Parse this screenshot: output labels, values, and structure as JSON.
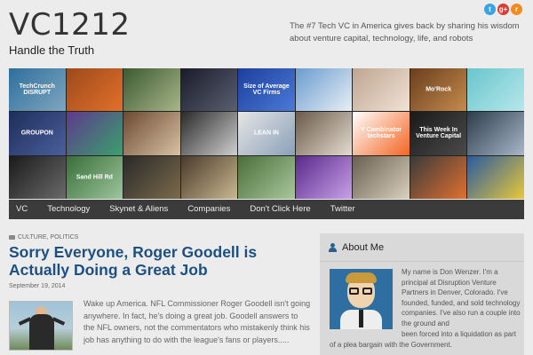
{
  "site": {
    "title": "VC1212",
    "tagline": "Handle the Truth",
    "description": "The #7 Tech VC in America gives back by sharing his wisdom about venture capital, technology, life, and robots"
  },
  "social": [
    {
      "name": "twitter",
      "glyph": "t",
      "color": "#3aa3e3"
    },
    {
      "name": "google-plus",
      "glyph": "g+",
      "color": "#d73d32"
    },
    {
      "name": "rss",
      "glyph": "r",
      "color": "#f28b1f"
    }
  ],
  "mosaic": [
    {
      "name": "techcrunch-disrupt",
      "label": "TechCrunch DISRUPT",
      "colors": [
        "#2e6f9c",
        "#7ea6c0"
      ]
    },
    {
      "name": "football-player",
      "label": "",
      "colors": [
        "#9c4a1c",
        "#e2702a"
      ]
    },
    {
      "name": "google-glass-portrait",
      "label": "",
      "colors": [
        "#3d5a30",
        "#a8b58a"
      ]
    },
    {
      "name": "terminator",
      "label": "",
      "colors": [
        "#1a1a2a",
        "#5a6070"
      ]
    },
    {
      "name": "vc-firms-chart",
      "label": "Size of Average VC Firms",
      "colors": [
        "#1d3f9c",
        "#4a7ad9"
      ]
    },
    {
      "name": "skier",
      "label": "",
      "colors": [
        "#6a9ccf",
        "#e8eff5"
      ]
    },
    {
      "name": "marissa-mayer",
      "label": "",
      "colors": [
        "#bfa590",
        "#f0e3d6"
      ]
    },
    {
      "name": "book-cover",
      "label": "Mo'Rock",
      "colors": [
        "#6a3e1e",
        "#c48b4d"
      ]
    },
    {
      "name": "whale-cartoon",
      "label": "",
      "colors": [
        "#69c5cd",
        "#b6e8ea"
      ]
    },
    {
      "name": "groupon-nasdaq",
      "label": "GROUPON",
      "colors": [
        "#1e2d5a",
        "#4a5f9c"
      ]
    },
    {
      "name": "app-icons",
      "label": "",
      "colors": [
        "#5d3a8c",
        "#3aa06e"
      ]
    },
    {
      "name": "instagram-logo",
      "label": "",
      "colors": [
        "#6b4a32",
        "#d8c2a4"
      ]
    },
    {
      "name": "two-men-portrait",
      "label": "",
      "colors": [
        "#2a2a2a",
        "#cfcfcf"
      ]
    },
    {
      "name": "lean-in-book",
      "label": "LEAN IN",
      "colors": [
        "#e6e6e6",
        "#8aa0b8"
      ]
    },
    {
      "name": "bee-gees",
      "label": "",
      "colors": [
        "#6a5a4a",
        "#e4dcd0"
      ]
    },
    {
      "name": "y-combinator-techstars",
      "label": "Y Combinator techstars",
      "colors": [
        "#ffffff",
        "#f26522"
      ]
    },
    {
      "name": "this-week-in-venture-capital",
      "label": "This Week In Venture Capital",
      "colors": [
        "#1a1a1a",
        "#4a4a4a"
      ]
    },
    {
      "name": "jeff-bezos",
      "label": "",
      "colors": [
        "#2d3b4a",
        "#a8b8c8"
      ]
    },
    {
      "name": "steve-jobs-apple",
      "label": "",
      "colors": [
        "#1a1a1a",
        "#6a6a6a"
      ]
    },
    {
      "name": "sand-hill-road-sign",
      "label": "Sand Hill Rd",
      "colors": [
        "#3a6e3a",
        "#9cc59c"
      ]
    },
    {
      "name": "batman-joker",
      "label": "",
      "colors": [
        "#2a2a2a",
        "#7a6a4a"
      ]
    },
    {
      "name": "breaking-bad",
      "label": "",
      "colors": [
        "#4a3a2a",
        "#c8b890"
      ]
    },
    {
      "name": "apple-campus",
      "label": "",
      "colors": [
        "#4a6e3a",
        "#a8c89c"
      ]
    },
    {
      "name": "prince-guitar",
      "label": "",
      "colors": [
        "#5a2a8c",
        "#c8a0e8"
      ]
    },
    {
      "name": "robots",
      "label": "",
      "colors": [
        "#6a6050",
        "#d8d0c0"
      ]
    },
    {
      "name": "3d-printer",
      "label": "",
      "colors": [
        "#3a3a3a",
        "#e07030"
      ]
    },
    {
      "name": "colorado-balloon",
      "label": "",
      "colors": [
        "#2a5aa0",
        "#e8c83a"
      ]
    }
  ],
  "nav": [
    "VC",
    "Technology",
    "Skynet & Aliens",
    "Companies",
    "Don't Click Here",
    "Twitter"
  ],
  "post": {
    "categories": "CULTURE, POLITICS",
    "title": "Sorry Everyone, Roger Goodell is Actually Doing a Great Job",
    "date": "September 19, 2014",
    "excerpt": "Wake up America. NFL Commissioner Roger Goodell isn't going anywhere. In fact, he's doing a great job. Goodell answers to the NFL owners, not the commentators who mistakenly think his job has anything to do with the league's fans or players....."
  },
  "sidebar": {
    "about_title": "About Me",
    "about_text_1": "My name is Don Wenzer. I'm a principal at Disruption Venture Partners in Denver, Colorado. I've founded, funded, and sold technology companies. I've also run a couple into the ground and",
    "about_text_2": "been forced into a liquidation as part of a plea bargain with the Government."
  }
}
